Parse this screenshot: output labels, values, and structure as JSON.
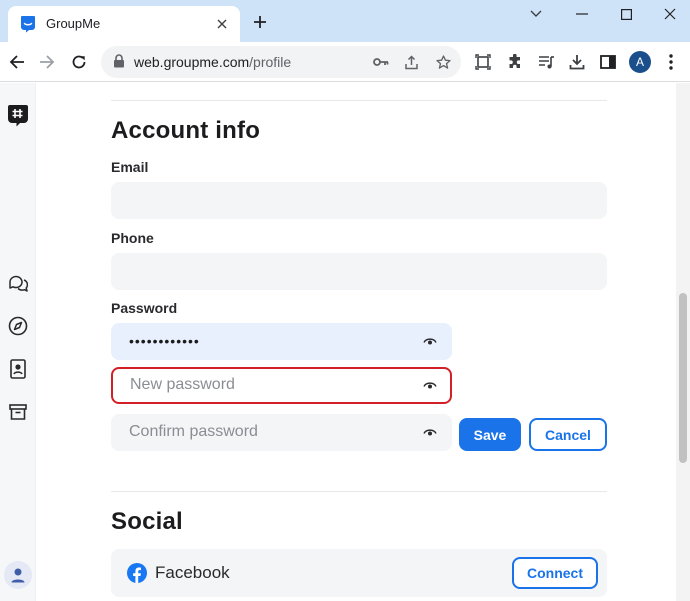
{
  "browser": {
    "tab_title": "GroupMe",
    "url_host": "web.groupme.com",
    "url_path": "/profile",
    "avatar_letter": "A"
  },
  "colors": {
    "accent": "#1a73e8",
    "focus_border": "#d32027",
    "tabbar_bg": "#cfe3f8"
  },
  "rail": {
    "icons": [
      "groupme-logo-icon",
      "chats-icon",
      "discover-icon",
      "contacts-icon",
      "archive-icon",
      "user-icon"
    ]
  },
  "account": {
    "title": "Account info",
    "email_label": "Email",
    "email_value": "",
    "phone_label": "Phone",
    "phone_value": "",
    "password_label": "Password",
    "password_value": "••••••••••••",
    "new_password_placeholder": "New password",
    "confirm_password_placeholder": "Confirm password",
    "save_label": "Save",
    "cancel_label": "Cancel"
  },
  "social": {
    "title": "Social",
    "facebook_label": "Facebook",
    "connect_label": "Connect"
  }
}
